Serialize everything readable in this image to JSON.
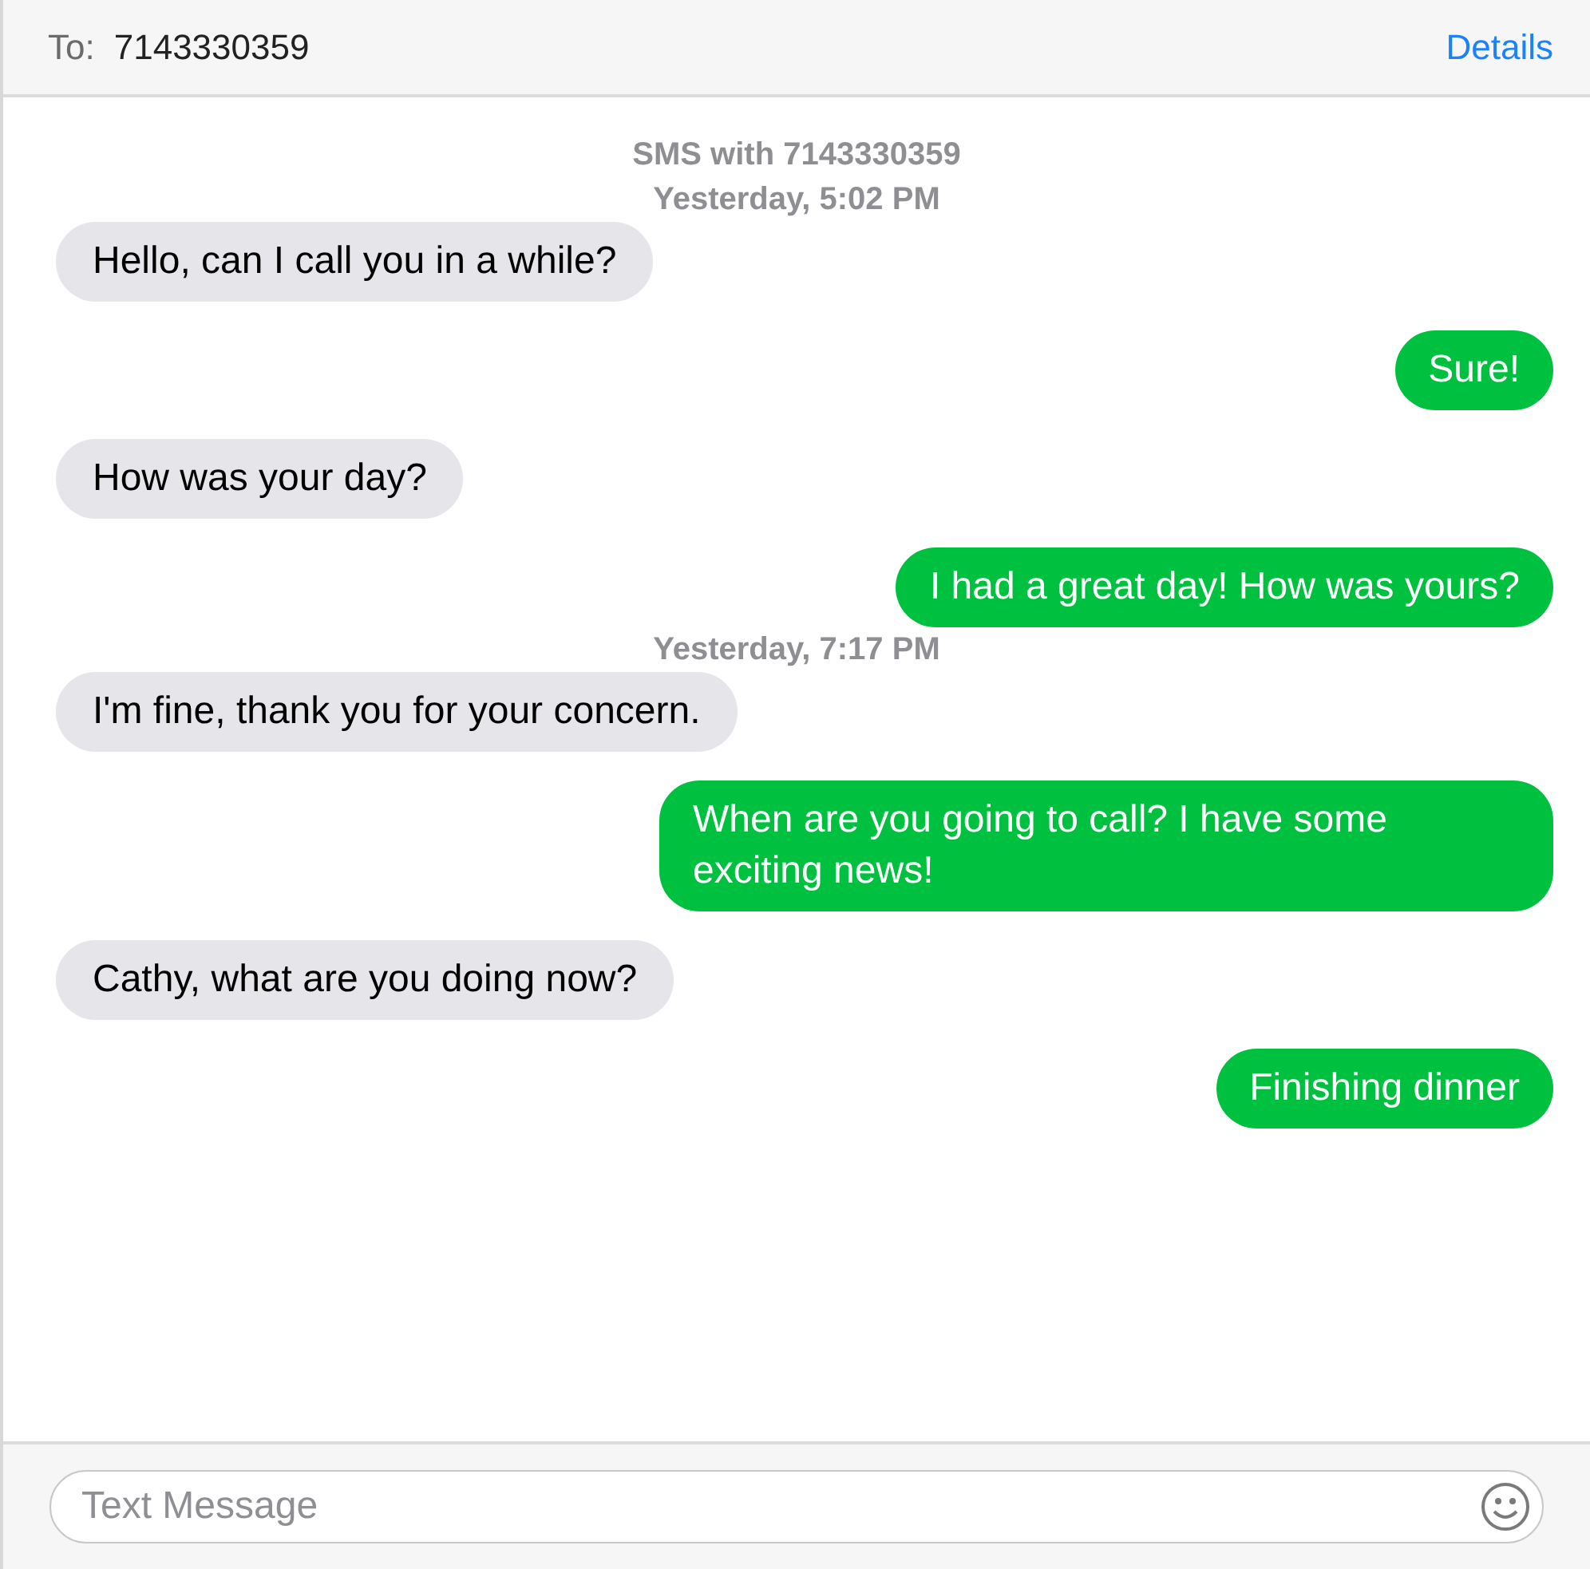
{
  "header": {
    "to_label": "To:",
    "recipient": "7143330359",
    "details": "Details"
  },
  "conversation": [
    {
      "kind": "stamp",
      "text": "SMS with 7143330359"
    },
    {
      "kind": "stamp",
      "text": "Yesterday, 5:02 PM"
    },
    {
      "kind": "received",
      "text": "Hello, can I call you in a while?"
    },
    {
      "kind": "sent",
      "text": "Sure!"
    },
    {
      "kind": "received",
      "text": "How was your day?"
    },
    {
      "kind": "sent",
      "text": "I had a great day! How was yours?"
    },
    {
      "kind": "stamp",
      "text": "Yesterday, 7:17 PM"
    },
    {
      "kind": "received",
      "text": "I'm fine, thank you for your concern."
    },
    {
      "kind": "sent",
      "text": "When are you going to call? I have some exciting news!"
    },
    {
      "kind": "received",
      "text": "Cathy, what are you doing now?"
    },
    {
      "kind": "sent",
      "text": "Finishing dinner"
    }
  ],
  "composer": {
    "placeholder": "Text Message"
  }
}
